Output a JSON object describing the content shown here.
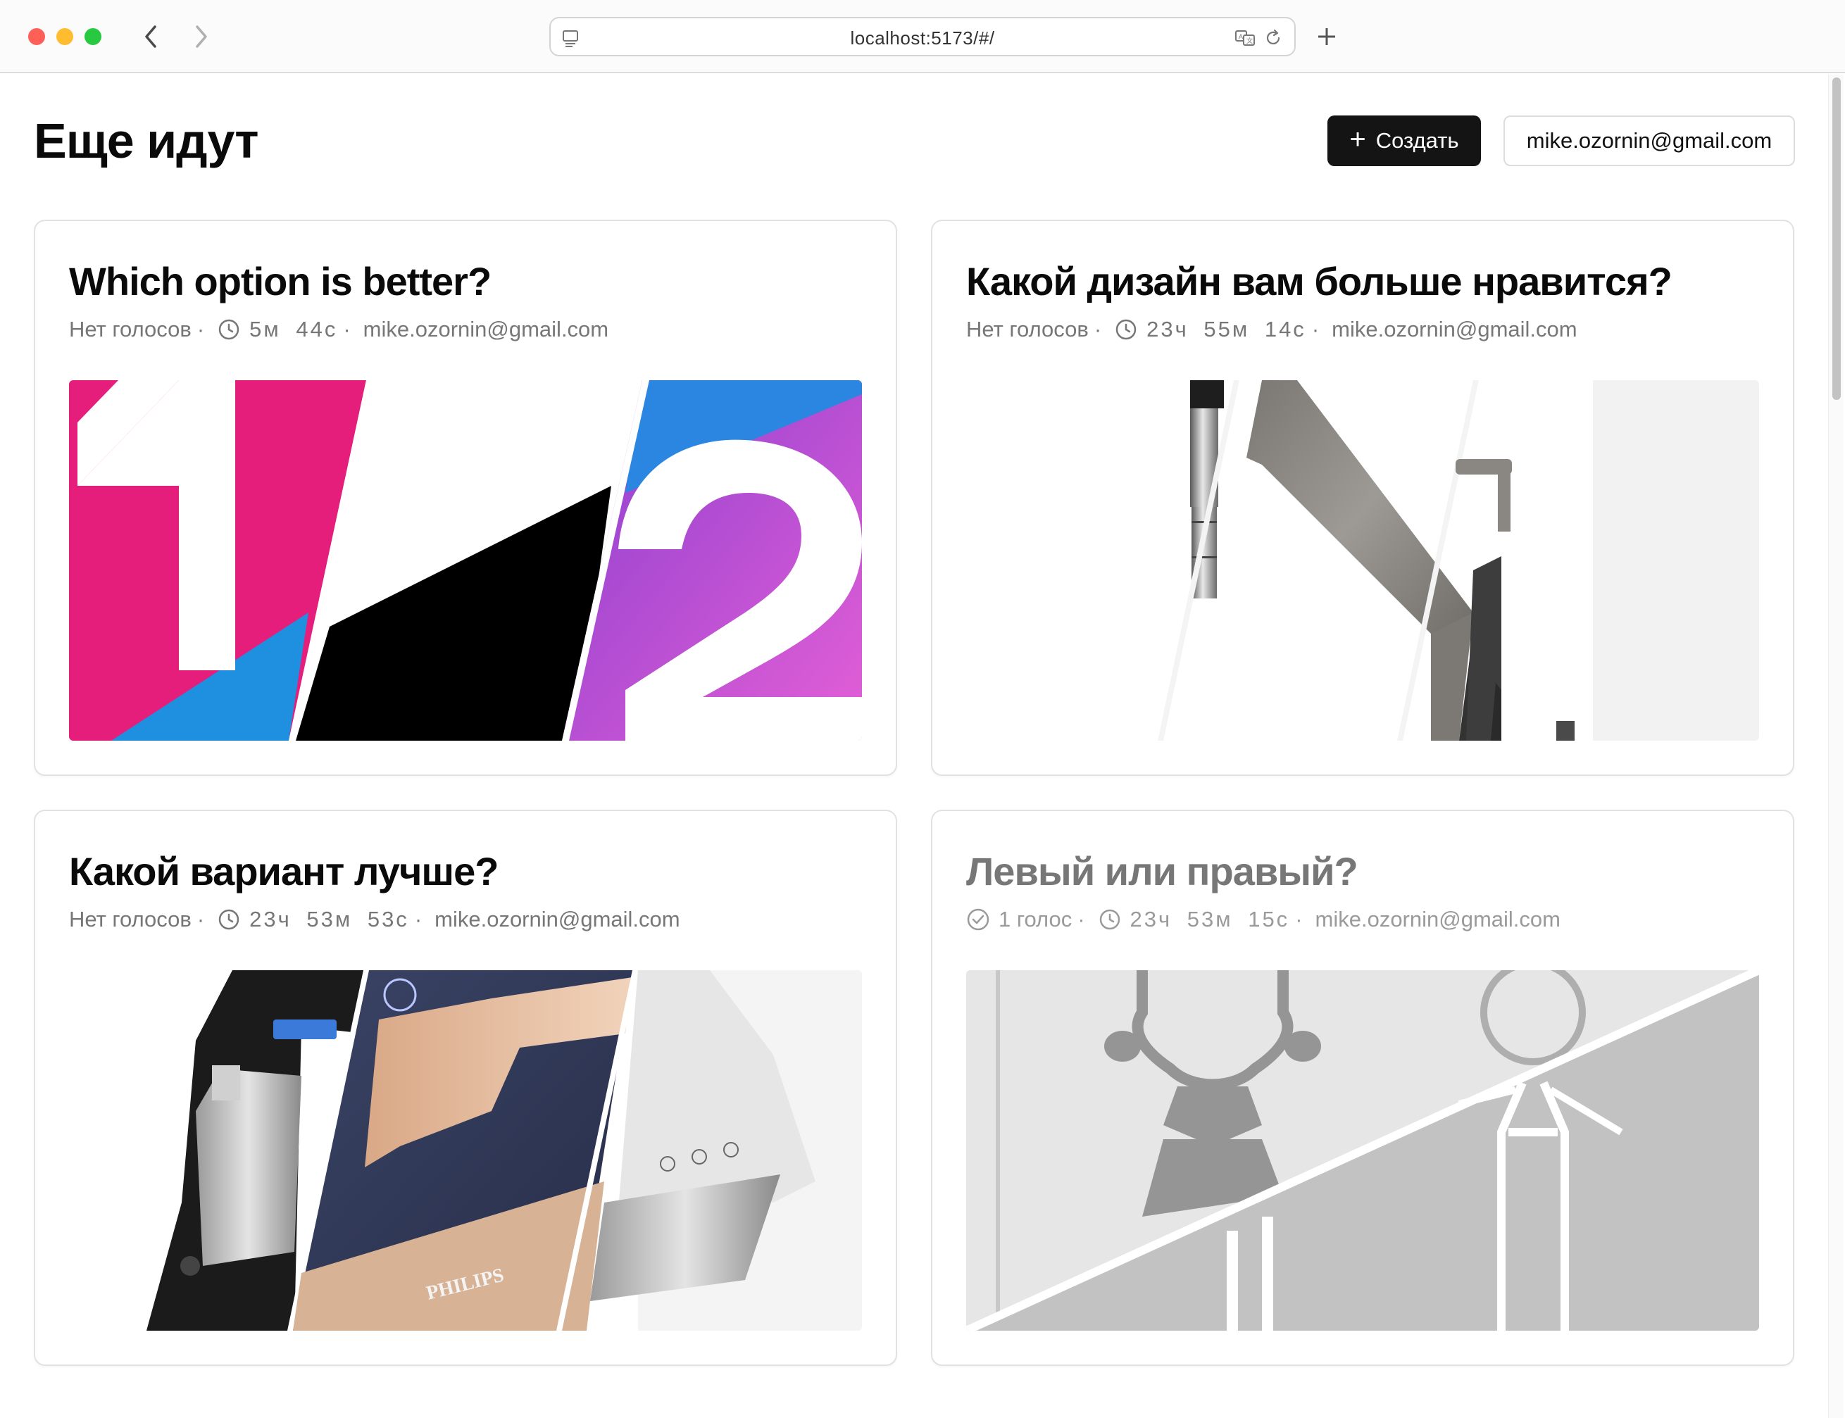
{
  "browser": {
    "url": "localhost:5173/#/",
    "icons": [
      "back-arrow-icon",
      "forward-arrow-icon",
      "page-icon",
      "translate-icon",
      "reload-icon",
      "new-tab-plus-icon"
    ]
  },
  "header": {
    "title": "Еще идут",
    "create_plus": "+",
    "create_label": "Создать",
    "user_email": "mike.ozornin@gmail.com"
  },
  "polls": [
    {
      "title": "Which option is better?",
      "votes": "Нет голосов",
      "time_left": "5м 44с",
      "author": "mike.ozornin@gmail.com",
      "status": "active",
      "image": "option-1-vs-2-graphic"
    },
    {
      "title": "Какой дизайн вам больше нравится?",
      "votes": "Нет голосов",
      "time_left": "23ч 55м 14с",
      "author": "mike.ozornin@gmail.com",
      "status": "active",
      "image": "faucet-designs"
    },
    {
      "title": "Какой вариант лучше?",
      "votes": "Нет голосов",
      "time_left": "23ч 53м 53с",
      "author": "mike.ozornin@gmail.com",
      "status": "active",
      "image": "steam-irons",
      "brand_label": "PHILIPS"
    },
    {
      "title": "Левый или правый?",
      "votes": "1 голос",
      "time_left": "23ч 53м 15с",
      "author": "mike.ozornin@gmail.com",
      "status": "voted",
      "image": "restroom-signs"
    }
  ],
  "separator": "·",
  "colors": {
    "primary_button": "#141414",
    "magenta": "#e5197b",
    "blue": "#1e8fe1",
    "purple": "#a94ad6",
    "muted_text": "#777777"
  }
}
